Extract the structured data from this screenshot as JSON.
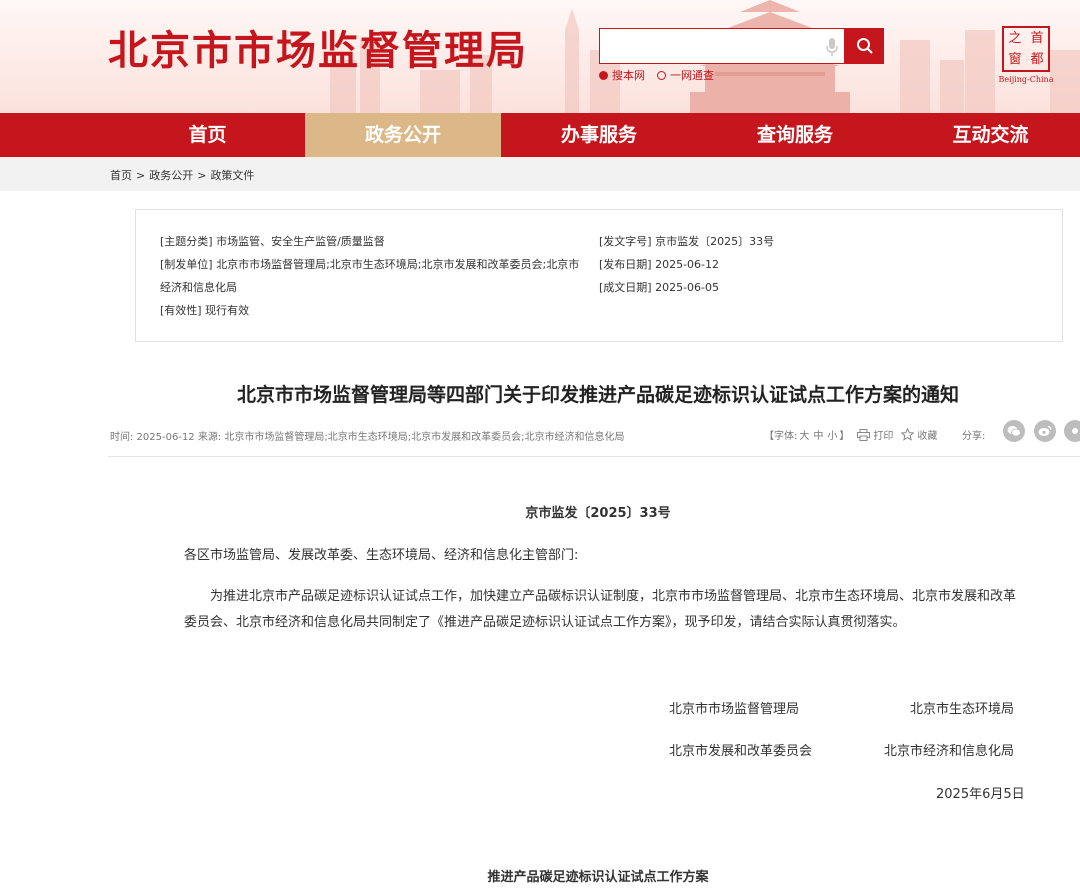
{
  "header": {
    "site_title": "北京市市场监督管理局",
    "search_placeholder": "",
    "search_options": [
      "搜本网",
      "一网通查"
    ],
    "logo_chars": [
      "之",
      "首",
      "窗",
      "都"
    ],
    "logo_sub": "Beijing-China"
  },
  "nav": {
    "items": [
      "首页",
      "政务公开",
      "办事服务",
      "查询服务",
      "互动交流"
    ],
    "active": "政务公开"
  },
  "breadcrumb": [
    "首页",
    "政务公开",
    "政策文件"
  ],
  "meta": {
    "subject_key": "[主题分类]",
    "subject_val": "市场监管、安全生产监管/质量监督",
    "issuer_key": "[制发单位]",
    "issuer_val_1": "北京市市场监督管理局;北京市生态环境局;北京市发展和改革委员会;北京市",
    "issuer_val_2": "经济和信息化局",
    "validity_key": "[有效性]",
    "validity_val": "现行有效",
    "docno_key": "[发文字号]",
    "docno_val": "京市监发〔2025〕33号",
    "pubdate_key": "[发布日期]",
    "pubdate_val": "2025-06-12",
    "madedate_key": "[成文日期]",
    "madedate_val": "2025-06-05"
  },
  "article": {
    "title": "北京市市场监督管理局等四部门关于印发推进产品碳足迹标识认证试点工作方案的通知",
    "info": "时间: 2025-06-12   来源: 北京市市场监督管理局;北京市生态环境局;北京市发展和改革委员会;北京市经济和信息化局",
    "font_label": "【字体:",
    "font_large": "大",
    "font_medium": "中",
    "font_small": "小",
    "font_close": "】",
    "print_label": "打印",
    "fav_label": "收藏",
    "share_label": "分享:",
    "doc_no": "京市监发〔2025〕33号",
    "salutation": "各区市场监管局、发展改革委、生态环境局、经济和信息化主管部门:",
    "body": "为推进北京市产品碳足迹标识认证试点工作，加快建立产品碳标识认证制度，北京市市场监督管理局、北京市生态环境局、北京市发展和改革委员会、北京市经济和信息化局共同制定了《推进产品碳足迹标识认证试点工作方案》，现予印发，请结合实际认真贯彻落实。",
    "signers": [
      "北京市市场监督管理局",
      "北京市生态环境局",
      "北京市发展和改革委员会",
      "北京市经济和信息化局"
    ],
    "date": "2025年6月5日",
    "plan_title": "推进产品碳足迹标识认证试点工作方案"
  },
  "colors": {
    "brand_red": "#c4161c",
    "active_gold": "#dcb889"
  }
}
